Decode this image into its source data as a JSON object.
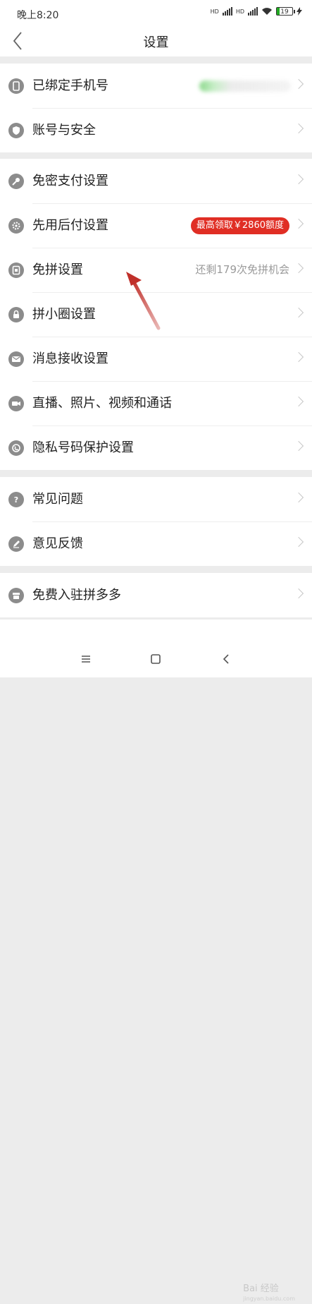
{
  "status_bar": {
    "time": "晚上8:20",
    "battery": "19",
    "battery_level": 0.19,
    "network_labels": [
      "HD",
      "HD"
    ]
  },
  "nav": {
    "title": "设置"
  },
  "sections": [
    {
      "items": [
        {
          "label": "已绑定手机号",
          "icon": "phone-icon",
          "value_blurred": true
        },
        {
          "label": "账号与安全",
          "icon": "shield-icon"
        }
      ]
    },
    {
      "items": [
        {
          "label": "免密支付设置",
          "icon": "key-icon"
        },
        {
          "label": "先用后付设置",
          "icon": "gear-icon",
          "badge": "最高领取￥2860额度"
        },
        {
          "label": "免拼设置",
          "icon": "card-icon",
          "value": "还剩179次免拼机会"
        },
        {
          "label": "拼小圈设置",
          "icon": "lock-icon"
        },
        {
          "label": "消息接收设置",
          "icon": "mail-icon"
        },
        {
          "label": "直播、照片、视频和通话",
          "icon": "camera-icon"
        },
        {
          "label": "隐私号码保护设置",
          "icon": "phone-circle-icon"
        }
      ]
    },
    {
      "items": [
        {
          "label": "常见问题",
          "icon": "question-icon"
        },
        {
          "label": "意见反馈",
          "icon": "pencil-icon"
        }
      ]
    },
    {
      "items": [
        {
          "label": "免费入驻拼多多",
          "icon": "store-icon"
        }
      ]
    }
  ],
  "watermark": {
    "text": "Bai 经验",
    "sub": "jingyan.baidu.com"
  },
  "colors": {
    "badge": "#e02e24",
    "annotation_arrow": "#c0302a",
    "icon_gray": "#8c8c8c"
  }
}
